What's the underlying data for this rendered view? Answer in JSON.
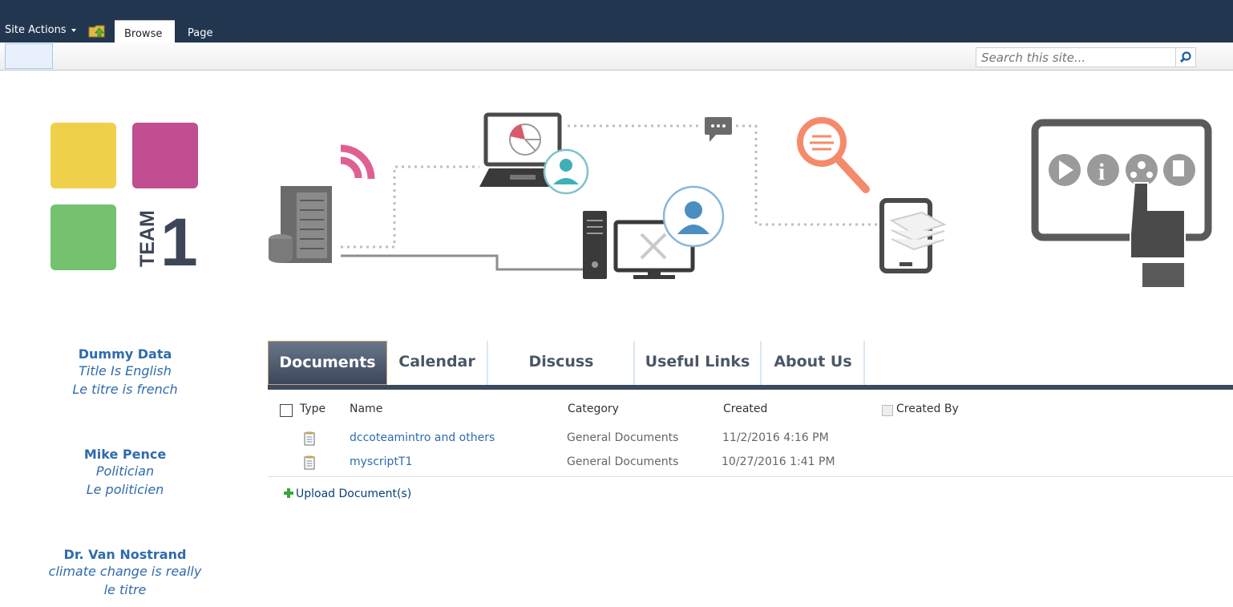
{
  "topbar": {
    "site_actions": "Site Actions",
    "tabs": [
      "Browse",
      "Page"
    ]
  },
  "search": {
    "placeholder": "Search this site..."
  },
  "logo": {
    "team_text": "TEAM",
    "team_number": "1"
  },
  "people": [
    {
      "name": "Dummy Data",
      "line1": "Title Is English",
      "line2": "Le titre is french"
    },
    {
      "name": "Mike Pence",
      "line1": "Politician",
      "line2": "Le politicien"
    },
    {
      "name": "Dr. Van Nostrand",
      "line1": "climate change is really",
      "line2": "le titre"
    }
  ],
  "tabs": [
    "Documents",
    "Calendar",
    "Discuss",
    "Useful Links",
    "About Us"
  ],
  "list": {
    "headers": {
      "type": "Type",
      "name": "Name",
      "category": "Category",
      "created": "Created",
      "created_by": "Created By"
    },
    "rows": [
      {
        "name": "dccoteamintro and others",
        "category": "General Documents",
        "created": "11/2/2016 4:16 PM"
      },
      {
        "name": "myscriptT1",
        "category": "General Documents",
        "created": "10/27/2016 1:41 PM"
      }
    ],
    "upload_label": "Upload Document(s)"
  },
  "colors": {
    "topbar": "#22374f",
    "link": "#2f6bad",
    "tab_active": "#3a475c",
    "tabs_line": "#3c4a5e"
  }
}
